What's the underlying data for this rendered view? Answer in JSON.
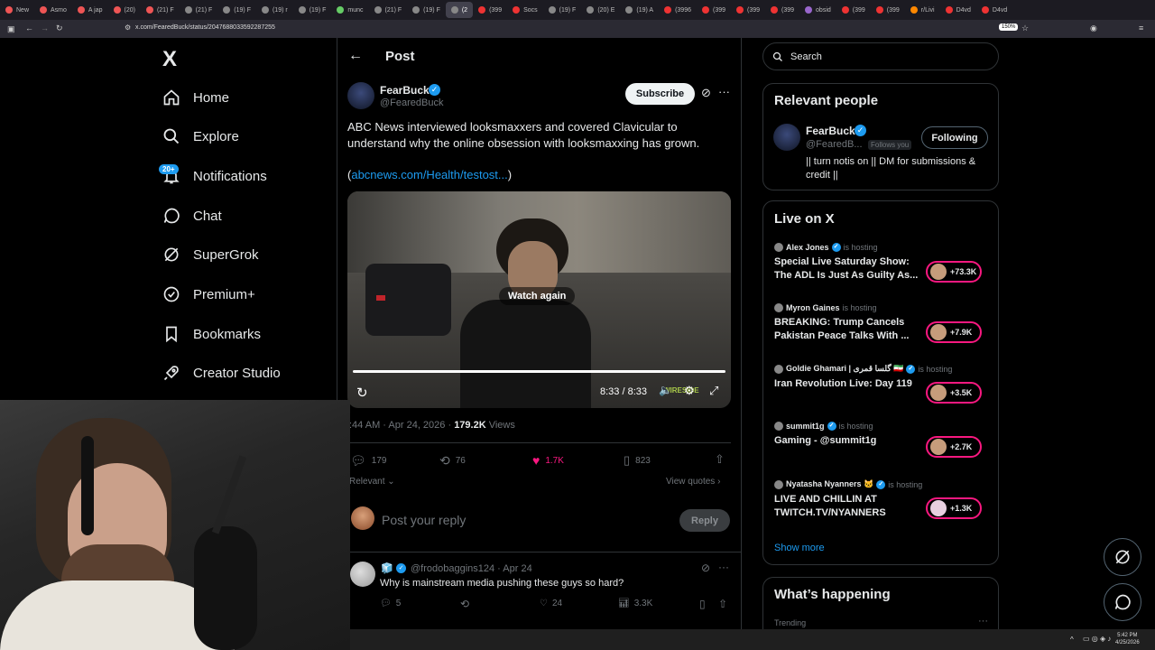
{
  "browser": {
    "tabs": [
      {
        "label": "New",
        "color": "#e55"
      },
      {
        "label": "Asmo",
        "color": "#e55"
      },
      {
        "label": "A jap",
        "color": "#e55"
      },
      {
        "label": "(20)",
        "color": "#e55"
      },
      {
        "label": "(21) F",
        "color": "#e55"
      },
      {
        "label": "(21) F",
        "color": "#888"
      },
      {
        "label": "(19) F",
        "color": "#888"
      },
      {
        "label": "(19) r",
        "color": "#888"
      },
      {
        "label": "(19) F",
        "color": "#888"
      },
      {
        "label": "munc",
        "color": "#6c6"
      },
      {
        "label": "(21) F",
        "color": "#888"
      },
      {
        "label": "(19) F",
        "color": "#888"
      },
      {
        "label": "(2",
        "color": "#888"
      },
      {
        "label": "(399",
        "color": "#e33"
      },
      {
        "label": "Socs",
        "color": "#e33"
      },
      {
        "label": "(19) F",
        "color": "#888"
      },
      {
        "label": "(20) E",
        "color": "#888"
      },
      {
        "label": "(19) A",
        "color": "#888"
      },
      {
        "label": "(3996",
        "color": "#e33"
      },
      {
        "label": "(399",
        "color": "#e33"
      },
      {
        "label": "(399",
        "color": "#e33"
      },
      {
        "label": "(399",
        "color": "#e33"
      },
      {
        "label": "obsid",
        "color": "#96c"
      },
      {
        "label": "(399",
        "color": "#e33"
      },
      {
        "label": "(399",
        "color": "#e33"
      },
      {
        "label": "r/Livi",
        "color": "#f80"
      },
      {
        "label": "D4vd",
        "color": "#e33"
      },
      {
        "label": "D4vd",
        "color": "#e33"
      }
    ],
    "url": "x.com/FearedBuck/status/2047688033592287255",
    "zoom": "150%"
  },
  "nav": {
    "logo": "X",
    "notif_badge": "20+",
    "items": [
      "Home",
      "Explore",
      "Notifications",
      "Chat",
      "SuperGrok",
      "Premium+",
      "Bookmarks",
      "Creator Studio"
    ]
  },
  "post": {
    "header": "Post",
    "author_name": "FearBuck",
    "author_handle": "@FearedBuck",
    "subscribe": "Subscribe",
    "text": "ABC News interviewed looksmaxxers and covered Clavicular to understand why the online obsession with looksmaxxing has grown.",
    "link_open": "(",
    "link": "abcnews.com/Health/testost...",
    "link_close": ")",
    "video_overlay": "Watch again",
    "video_time": "8:33 / 8:33",
    "watermark": "WIRESIDE",
    "timestamp": ":44 AM · Apr 24, 2026 · ",
    "views_count": "179.2K",
    "views_label": " Views",
    "replies": "179",
    "reposts": "76",
    "likes": "1.7K",
    "bookmarks": "823",
    "sort": "Relevant",
    "view_quotes": "View quotes",
    "reply_placeholder": "Post your reply",
    "reply_button": "Reply"
  },
  "reply": {
    "handle": "@frodobaggins124 · Apr 24",
    "text": "Why is mainstream media pushing these guys so hard?",
    "replies": "5",
    "likes": "24",
    "views": "3.3K"
  },
  "sidebar": {
    "search_placeholder": "Search",
    "relevant_title": "Relevant people",
    "person_name": "FearBuck",
    "person_handle": "@FearedB...",
    "follows_you": "Follows you",
    "following": "Following",
    "bio": "|| turn notis on || DM for submissions & credit ||",
    "live_title": "Live on X",
    "is_hosting": "is hosting",
    "live": [
      {
        "host": "Alex Jones",
        "title": "Special Live Saturday Show: The ADL Is Just As Guilty As...",
        "count": "+73.3K"
      },
      {
        "host": "Myron Gaines",
        "title": "BREAKING: Trump Cancels Pakistan Peace Talks With ...",
        "count": "+7.9K"
      },
      {
        "host": "Goldie Ghamari | گلسا قمری 🇮🇷",
        "title": "Iran Revolution Live: Day 119",
        "count": "+3.5K"
      },
      {
        "host": "summit1g",
        "title": "Gaming - @summit1g",
        "count": "+2.7K"
      },
      {
        "host": "Nyatasha Nyanners 🐱",
        "title": "LIVE AND CHILLIN AT TWITCH.TV/NYANNERS",
        "count": "+1.3K"
      }
    ],
    "show_more": "Show more",
    "happening_title": "What’s happening",
    "trending": "Trending"
  },
  "taskbar": {
    "time": "5:42 PM",
    "date": "4/25/2026"
  }
}
